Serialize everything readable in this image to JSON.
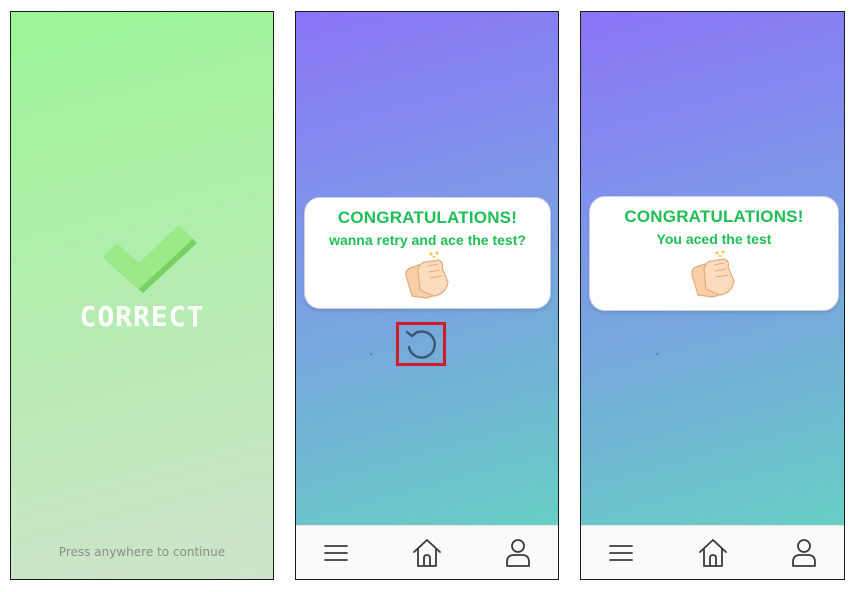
{
  "screen1": {
    "title": "CORRECT",
    "hint": "Press anywhere to continue"
  },
  "screen2": {
    "card": {
      "title": "CONGRATULATIONS!",
      "subtitle": "wanna retry and ace the test?"
    },
    "retry_icon": "retry-icon"
  },
  "screen3": {
    "card": {
      "title": "CONGRATULATIONS!",
      "subtitle": "You aced the test"
    }
  },
  "navbar": {
    "icons": [
      "menu-icon",
      "home-icon",
      "profile-icon"
    ]
  },
  "colors": {
    "success_green": "#1ebf54",
    "check_green": "#8ee07a",
    "retry_highlight": "#d11a2a",
    "gradient_top": "#8a74f6",
    "gradient_bottom": "#67cfc4"
  }
}
